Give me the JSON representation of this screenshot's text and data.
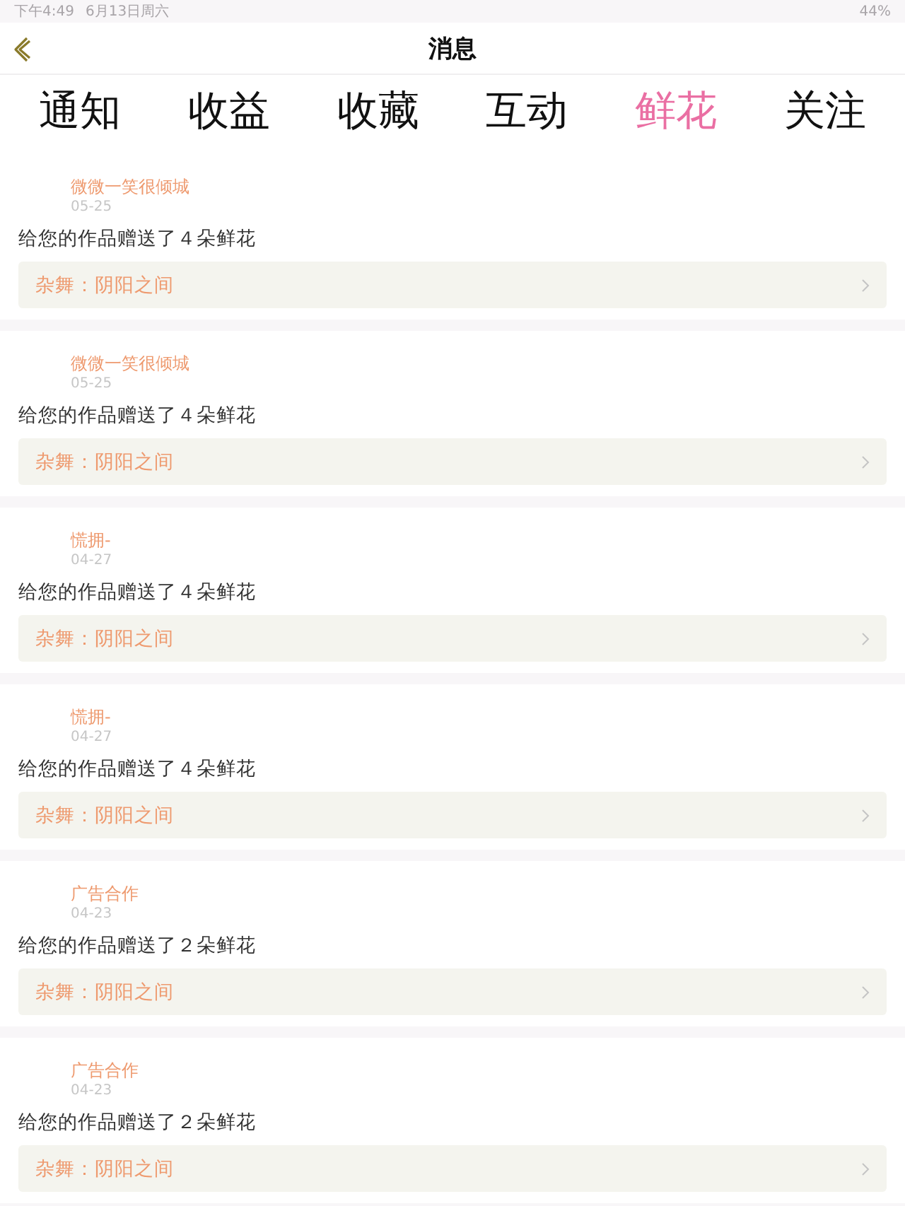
{
  "status_bar": {
    "time": "下午4:49",
    "date": "6月13日周六",
    "battery": "44%"
  },
  "header": {
    "title": "消息"
  },
  "tabs": [
    {
      "label": "通知",
      "selected": false
    },
    {
      "label": "收益",
      "selected": false
    },
    {
      "label": "收藏",
      "selected": false
    },
    {
      "label": "互动",
      "selected": false
    },
    {
      "label": "鲜花",
      "selected": true
    },
    {
      "label": "关注",
      "selected": false
    }
  ],
  "messages": [
    {
      "sender": "微微一笑很倾城",
      "date": "05-25",
      "text": "给您的作品赠送了４朵鲜花",
      "work": "杂舞：阴阳之间"
    },
    {
      "sender": "微微一笑很倾城",
      "date": "05-25",
      "text": "给您的作品赠送了４朵鲜花",
      "work": "杂舞：阴阳之间"
    },
    {
      "sender": "慌拥-",
      "date": "04-27",
      "text": "给您的作品赠送了４朵鲜花",
      "work": "杂舞：阴阳之间"
    },
    {
      "sender": "慌拥-",
      "date": "04-27",
      "text": "给您的作品赠送了４朵鲜花",
      "work": "杂舞：阴阳之间"
    },
    {
      "sender": "广告合作",
      "date": "04-23",
      "text": "给您的作品赠送了２朵鲜花",
      "work": "杂舞：阴阳之间"
    },
    {
      "sender": "广告合作",
      "date": "04-23",
      "text": "给您的作品赠送了２朵鲜花",
      "work": "杂舞：阴阳之间"
    }
  ]
}
